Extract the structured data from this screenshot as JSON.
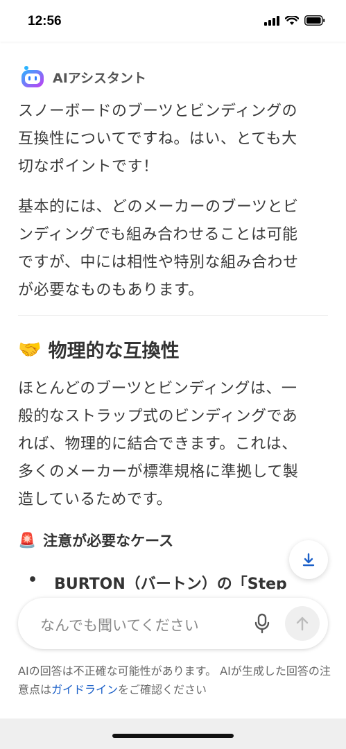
{
  "status_bar": {
    "time": "12:56"
  },
  "assistant": {
    "name": "AIアシスタント"
  },
  "message": {
    "paragraphs": [
      [
        "スノーボードのブーツとビンディングの",
        "互換性についてですね。はい、とても大",
        "切なポイントです！"
      ],
      [
        "基本的には、どのメーカーのブーツとビ",
        "ンディングでも組み合わせることは可能",
        "ですが、中には相性や特別な組み合わせ",
        "が必要なものもあります。"
      ]
    ],
    "section_title": {
      "emoji": "🤝",
      "text": "物理的な互換性"
    },
    "section_paragraph": [
      "ほとんどのブーツとビンディングは、一",
      "般的なストラップ式のビンディングであ",
      "れば、物理的に結合できます。これは、",
      "多くのメーカーが標準規格に準拠して製",
      "造しているためです。"
    ],
    "sub_title": {
      "emoji": "🚨",
      "text": "注意が必要なケース"
    },
    "bullet": {
      "marker": "•",
      "text": "BURTON（バートン）の「Step"
    }
  },
  "input": {
    "placeholder": "なんでも聞いてください"
  },
  "disclaimer": {
    "before": "AIの回答は不正確な可能性があります。 AIが生成した回答の注意点は",
    "link": "ガイドライン",
    "after": "をご確認ください"
  },
  "icons": {
    "assistant": "assistant-bot-icon",
    "mic": "microphone-icon",
    "send": "send-arrow-icon",
    "scroll": "scroll-down-icon"
  },
  "colors": {
    "accent": "#1a5fc8",
    "text": "#3a3a3a",
    "bot_gradient_start": "#2bb3ff",
    "bot_gradient_end": "#c43cf2"
  }
}
